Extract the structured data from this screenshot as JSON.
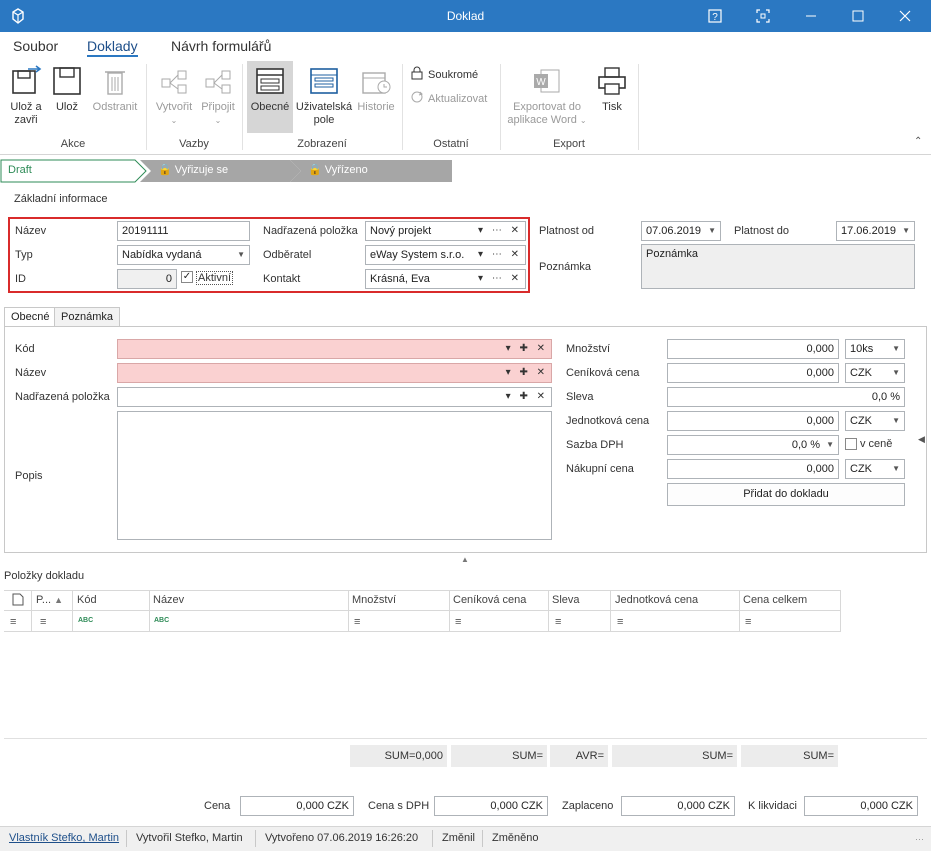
{
  "window": {
    "title": "Doklad"
  },
  "ribbon_tabs": [
    "Soubor",
    "Doklady",
    "Návrh formulářů"
  ],
  "ribbon": {
    "groups": {
      "akce": "Akce",
      "vazby": "Vazby",
      "zobrazeni": "Zobrazení",
      "ostatni": "Ostatní",
      "export": "Export"
    },
    "buttons": {
      "save_close": [
        "Ulož a",
        "zavři"
      ],
      "save": "Ulož",
      "delete": "Odstranit",
      "create": "Vytvořit",
      "attach": "Připojit",
      "general": "Obecné",
      "user_fields": [
        "Uživatelská",
        "pole"
      ],
      "history": "Historie",
      "private": "Soukromé",
      "update": "Aktualizovat",
      "export_word": [
        "Exportovat do",
        "aplikace Word"
      ],
      "print": "Tisk"
    }
  },
  "workflow": [
    "Draft",
    "Vyřizuje se",
    "Vyřízeno"
  ],
  "basic_info": {
    "section": "Základní informace",
    "name_label": "Název",
    "name_value": "20191111",
    "type_label": "Typ",
    "type_value": "Nabídka vydaná",
    "id_label": "ID",
    "id_value": "0",
    "active_label": "Aktivní",
    "parent_label": "Nadřazená položka",
    "parent_value": "Nový projekt",
    "customer_label": "Odběratel",
    "customer_value": "eWay System s.r.o.",
    "contact_label": "Kontakt",
    "contact_value": "Krásná, Eva",
    "valid_from_label": "Platnost od",
    "valid_from_value": "07.06.2019",
    "valid_to_label": "Platnost do",
    "valid_to_value": "17.06.2019",
    "note_label": "Poznámka",
    "note_placeholder": "Poznámka"
  },
  "tabs": [
    "Obecné",
    "Poznámka"
  ],
  "item_form": {
    "code_label": "Kód",
    "name_label": "Název",
    "parent_label": "Nadřazená položka",
    "desc_label": "Popis",
    "qty_label": "Množství",
    "qty_value": "0,000",
    "qty_unit": "10ks",
    "list_price_label": "Ceníková cena",
    "list_price_value": "0,000",
    "list_price_cur": "CZK",
    "discount_label": "Sleva",
    "discount_value": "0,0 %",
    "unit_price_label": "Jednotková cena",
    "unit_price_value": "0,000",
    "unit_price_cur": "CZK",
    "vat_label": "Sazba DPH",
    "vat_value": "0,0 %",
    "vat_incl_label": "v ceně",
    "purchase_label": "Nákupní cena",
    "purchase_value": "0,000",
    "purchase_cur": "CZK",
    "add_button": "Přidat do dokladu"
  },
  "items_grid": {
    "title": "Položky dokladu",
    "columns": [
      "P...",
      "Kód",
      "Název",
      "Množství",
      "Ceníková cena",
      "Sleva",
      "Jednotková cena",
      "Cena celkem"
    ],
    "sums": [
      "SUM=0,000",
      "SUM=",
      "AVR=",
      "SUM=",
      "SUM="
    ]
  },
  "totals": {
    "price_label": "Cena",
    "price_value": "0,000 CZK",
    "price_vat_label": "Cena s DPH",
    "price_vat_value": "0,000 CZK",
    "paid_label": "Zaplaceno",
    "paid_value": "0,000 CZK",
    "to_pay_label": "K likvidaci",
    "to_pay_value": "0,000 CZK"
  },
  "status_bar": {
    "owner": "Vlastník Stefko, Martin",
    "created_by": "Vytvořil Stefko, Martin",
    "created": "Vytvořeno 07.06.2019 16:26:20",
    "changed_by": "Změnil",
    "changed": "Změněno"
  },
  "colors": {
    "titlebar": "#2b78c2",
    "highlight_border": "#d92b2b",
    "required_bg": "#fad1d1",
    "workflow_active": "#2e8b57",
    "workflow_inactive": "#a6a6a6"
  }
}
